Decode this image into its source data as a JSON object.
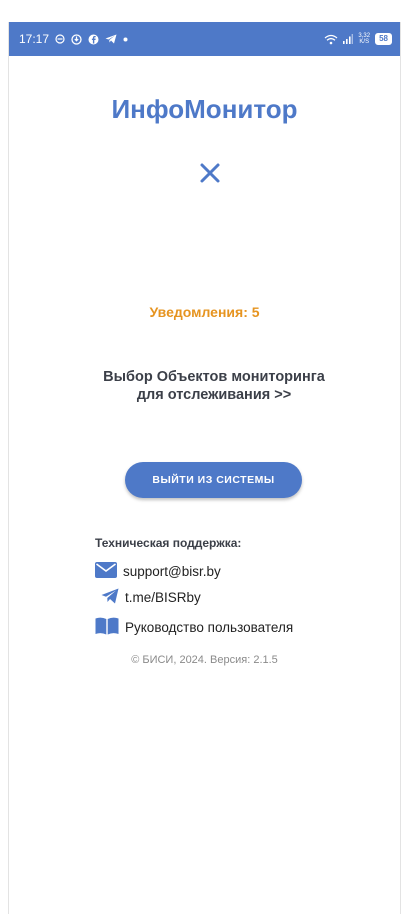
{
  "statusbar": {
    "time": "17:17",
    "net_speed_value": "3,32",
    "net_speed_unit": "K/S",
    "battery": "58"
  },
  "app": {
    "title": "ИнфоМонитор"
  },
  "main": {
    "notifications": "Уведомления: 5",
    "select_objects_line1": "Выбор Объектов мониторинга",
    "select_objects_line2": "для отслеживания >>",
    "logout_label": "ВЫЙТИ ИЗ СИСТЕМЫ"
  },
  "support": {
    "title": "Техническая поддержка:",
    "email": "support@bisr.by",
    "telegram": "t.me/BISRby",
    "guide": "Руководство пользователя"
  },
  "footer": {
    "copyright": "© БИСИ, 2024. Версия: 2.1.5"
  },
  "colors": {
    "accent": "#4e79c8",
    "notification": "#e69420",
    "text_dark": "#3b3f48"
  }
}
